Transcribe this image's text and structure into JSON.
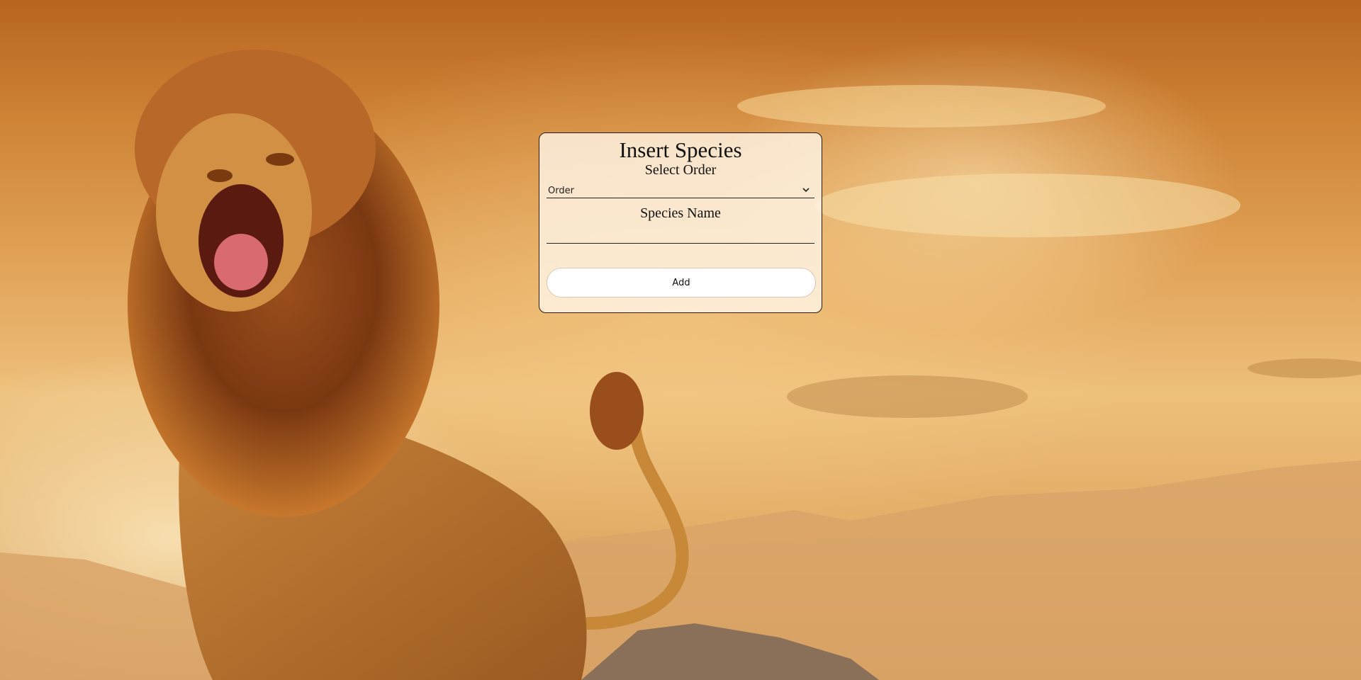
{
  "form": {
    "title": "Insert Species",
    "order_label": "Select Order",
    "order_select": {
      "selected": "Order",
      "icon": "chevron-down-icon"
    },
    "species_label": "Species Name",
    "species_input": {
      "value": "",
      "placeholder": ""
    },
    "add_button_label": "Add"
  },
  "colors": {
    "card_background": "#fff6e8",
    "card_border": "#2a1a10",
    "button_background": "#ffffff",
    "sky_warm": "#cf8436"
  }
}
